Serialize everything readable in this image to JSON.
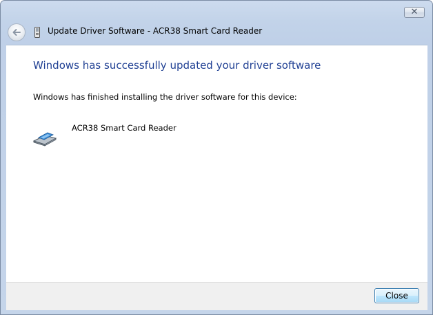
{
  "window": {
    "title": "Update Driver Software - ACR38 Smart Card Reader",
    "close_glyph": "✕"
  },
  "content": {
    "heading": "Windows has successfully updated your driver software",
    "description": "Windows has finished installing the driver software for this device:",
    "device_name": "ACR38 Smart Card Reader"
  },
  "footer": {
    "close_label": "Close"
  },
  "icons": {
    "back": "back-arrow-icon",
    "title": "device-manager-icon",
    "device": "smart-card-reader-icon"
  },
  "colors": {
    "heading": "#1f3f93",
    "frame": "#c2d3e9",
    "footer": "#f0f0f0"
  }
}
